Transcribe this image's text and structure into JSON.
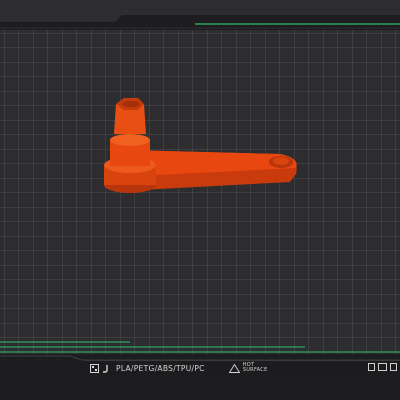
{
  "bed": {
    "material_label": "PLA/PETG/ABS/TPU/PC",
    "hot_surface_text": "HOT SURFACE",
    "logo_icon": "printer-logo-icon",
    "warning_icon": "hot-surface-warning-icon"
  },
  "model": {
    "color": "#e8470f",
    "name_icon": "part-model"
  },
  "colors": {
    "grid_background": "#2d2d30",
    "grid_line": "#5b5b60",
    "accent_green": "#2fbf6a",
    "frame_dark": "#1c1c1e"
  }
}
